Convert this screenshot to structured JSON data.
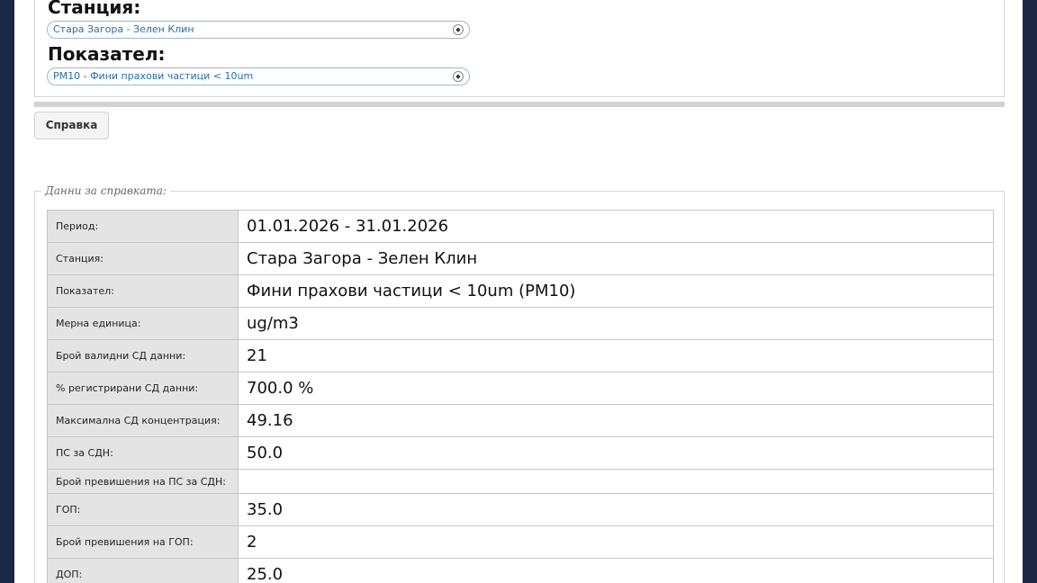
{
  "form": {
    "station_label": "Станция:",
    "station_value": "Стара Загора - Зелен Клин",
    "indicator_label": "Показател:",
    "indicator_value": "PM10 - Фини прахови частици < 10um",
    "submit_label": "Справка"
  },
  "report": {
    "legend": "Данни за справката:",
    "rows": [
      {
        "label": "Период:",
        "value": "01.01.2026 - 31.01.2026"
      },
      {
        "label": "Станция:",
        "value": "Стара Загора - Зелен Клин"
      },
      {
        "label": "Показател:",
        "value": "Фини прахови частици < 10um (PM10)"
      },
      {
        "label": "Мерна единица:",
        "value": "ug/m3"
      },
      {
        "label": "Брой валидни СД данни:",
        "value": "21"
      },
      {
        "label": "% регистрирани СД данни:",
        "value": "700.0 %"
      },
      {
        "label": "Максимална СД концентрация:",
        "value": "49.16"
      },
      {
        "label": "ПС за СДН:",
        "value": "50.0"
      },
      {
        "label": "Брой превишения на ПС за СДН:",
        "value": ""
      },
      {
        "label": "ГОП:",
        "value": "35.0"
      },
      {
        "label": "Брой превишения на ГОП:",
        "value": "2"
      },
      {
        "label": "ДОП:",
        "value": "25.0"
      }
    ]
  }
}
